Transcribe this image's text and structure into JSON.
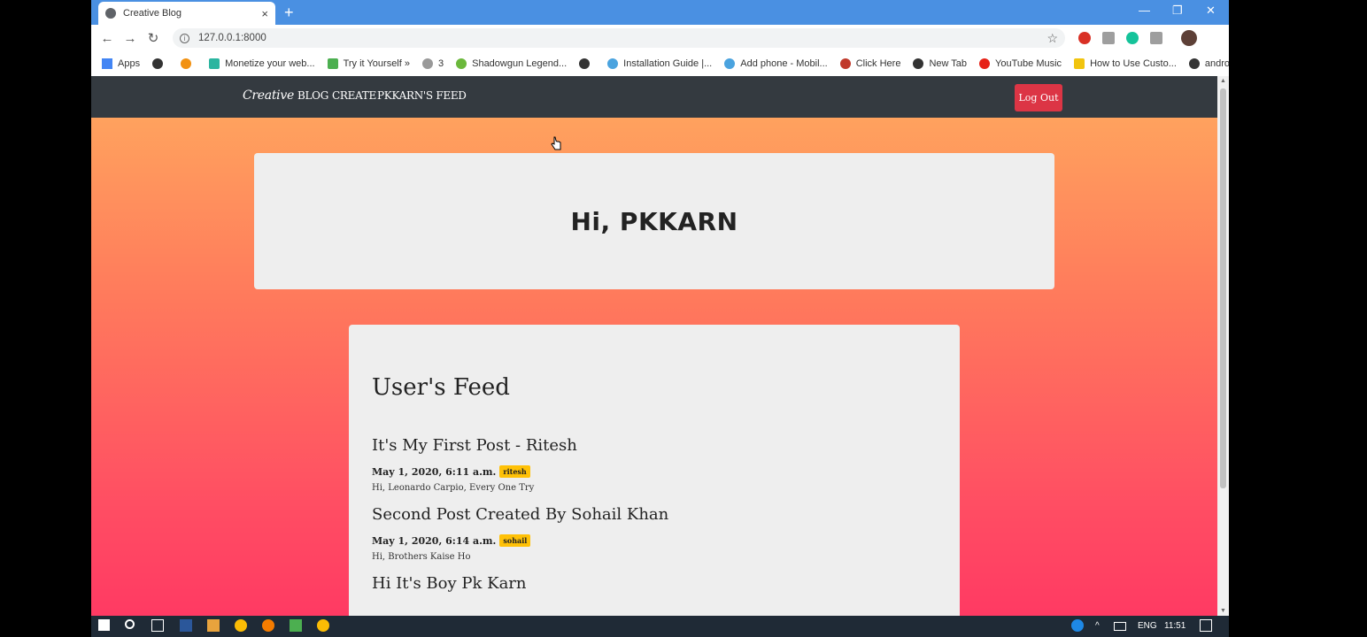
{
  "browser": {
    "tab_title": "Creative Blog",
    "tab_close": "×",
    "new_tab": "+",
    "url": "127.0.0.1:8000",
    "window_controls": {
      "minimize": "—",
      "restore": "❐",
      "close": "✕"
    },
    "bookmarks": [
      {
        "label": "Apps",
        "color": "#4285f4"
      },
      {
        "label": "",
        "color": "#333333"
      },
      {
        "label": "",
        "color": "#f29111"
      },
      {
        "label": "Monetize your web...",
        "color": "#2bb5a0"
      },
      {
        "label": "Try it Yourself »",
        "color": "#4caf50"
      },
      {
        "label": "3",
        "color": "#999999"
      },
      {
        "label": "Shadowgun Legend...",
        "color": "#6bb83c"
      },
      {
        "label": "",
        "color": "#333333"
      },
      {
        "label": "Installation Guide |...",
        "color": "#4aa3df"
      },
      {
        "label": "Add phone - Mobil...",
        "color": "#4aa3df"
      },
      {
        "label": "Click Here",
        "color": "#c0392b"
      },
      {
        "label": "New Tab",
        "color": "#333333"
      },
      {
        "label": "YouTube Music",
        "color": "#e62117"
      },
      {
        "label": "How to Use Custo...",
        "color": "#f1c40f"
      },
      {
        "label": "android",
        "color": "#333333"
      }
    ]
  },
  "site": {
    "brand": "Creative",
    "nav": [
      "BLOG",
      "CREATE",
      "PKKARN'S FEED"
    ],
    "logout": "Log Out"
  },
  "hero": {
    "greeting": "Hi, PKKARN"
  },
  "feed": {
    "title": "User's Feed",
    "posts": [
      {
        "title": "It's My First Post - Ritesh",
        "date": "May 1, 2020, 6:11 a.m.",
        "author": "ritesh",
        "body": "Hi, Leonardo Carpio, Every One Try"
      },
      {
        "title": "Second Post Created By Sohail Khan",
        "date": "May 1, 2020, 6:14 a.m.",
        "author": "sohail",
        "body": "Hi, Brothers Kaise Ho"
      },
      {
        "title": "Hi It's Boy Pk Karn",
        "date": "",
        "author": "",
        "body": ""
      }
    ]
  },
  "taskbar": {
    "language": "ENG",
    "time": "11:51"
  },
  "colors": {
    "nav_bg": "#343a40",
    "logout": "#dc3545",
    "badge": "#ffc107",
    "titlebar": "#4a90e2"
  }
}
